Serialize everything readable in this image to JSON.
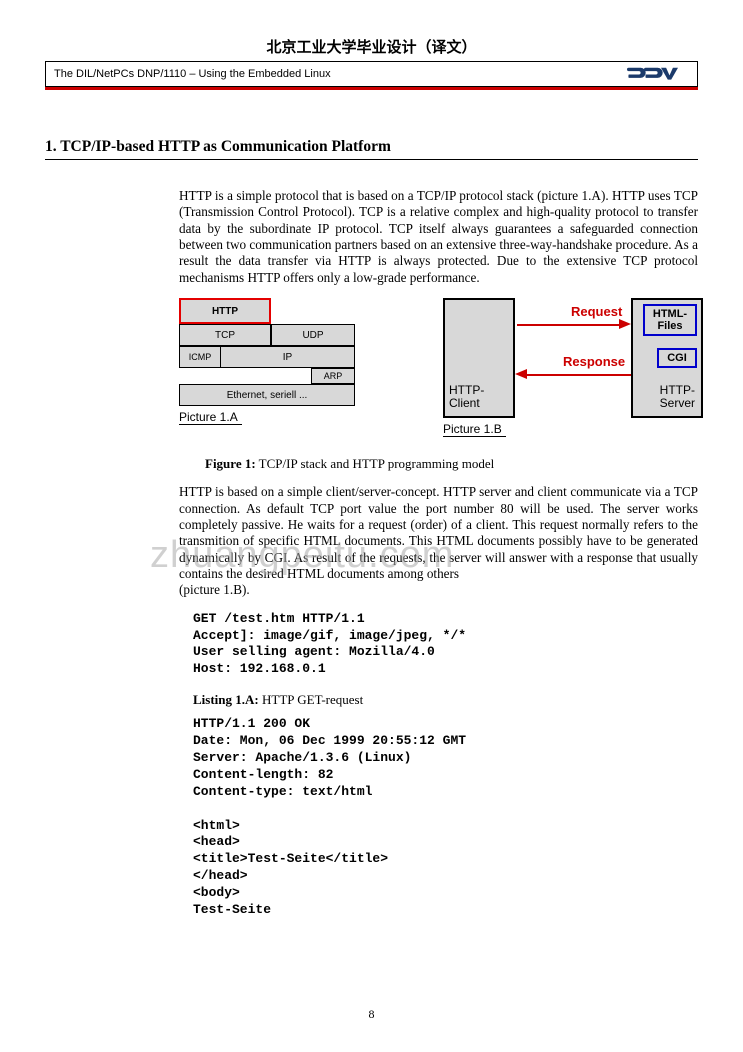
{
  "top_title": "北京工业大学毕业设计（译文）",
  "header_left": "The DIL/NetPCs DNP/1110 – Using the Embedded Linux",
  "logo_text": "SSV",
  "section_title": "1. TCP/IP-based HTTP as Communication Platform",
  "para1": "HTTP is a simple protocol that is based on a TCP/IP protocol stack (picture 1.A). HTTP uses TCP (Transmission Control Protocol). TCP is a relative complex and high-quality protocol to transfer data by the subordinate IP protocol. TCP itself always guarantees a safeguarded connection between two communication partners based on an extensive three-way-handshake procedure. As a result the data transfer via HTTP is always protected. Due to the extensive TCP protocol mechanisms HTTP offers only a low-grade performance.",
  "stack": {
    "http": "HTTP",
    "tcp": "TCP",
    "udp": "UDP",
    "icmp": "ICMP",
    "ip": "IP",
    "arp": "ARP",
    "eth": "Ethernet, seriell ...",
    "pic_a": "Picture 1.A"
  },
  "diagram": {
    "client": "HTTP-\nClient",
    "server": "HTTP-\nServer",
    "html_files": "HTML-\nFiles",
    "cgi": "CGI",
    "request": "Request",
    "response": "Response",
    "pic_b": "Picture 1.B"
  },
  "fig_caption_bold": "Figure 1:",
  "fig_caption_rest": " TCP/IP stack and HTTP programming model",
  "para2": "HTTP is based on a simple client/server-concept. HTTP server and client communicate via a TCP connection. As default TCP port value the port number 80 will be used. The server works completely passive. He waits for a request (order) of a client. This request normally refers to the transmition of specific HTML documents. This HTML documents possibly have to be generated dynamically by CGI. As result of the requests, the server will answer with a response that usually contains the desired HTML documents among others",
  "para2b": "(picture 1.B).",
  "code1": "GET /test.htm HTTP/1.1\nAccept]: image/gif, image/jpeg, */*\nUser selling agent: Mozilla/4.0\nHost: 192.168.0.1",
  "listing_bold": "Listing 1.A:",
  "listing_rest": " HTTP GET-request",
  "code2": "HTTP/1.1 200 OK\nDate: Mon, 06 Dec 1999 20:55:12 GMT\nServer: Apache/1.3.6 (Linux)\nContent-length: 82\nContent-type: text/html\n\n<html>\n<head>\n<title>Test-Seite</title>\n</head>\n<body>\nTest-Seite",
  "page_num": "8",
  "watermark": "zhuangpeitu.com"
}
